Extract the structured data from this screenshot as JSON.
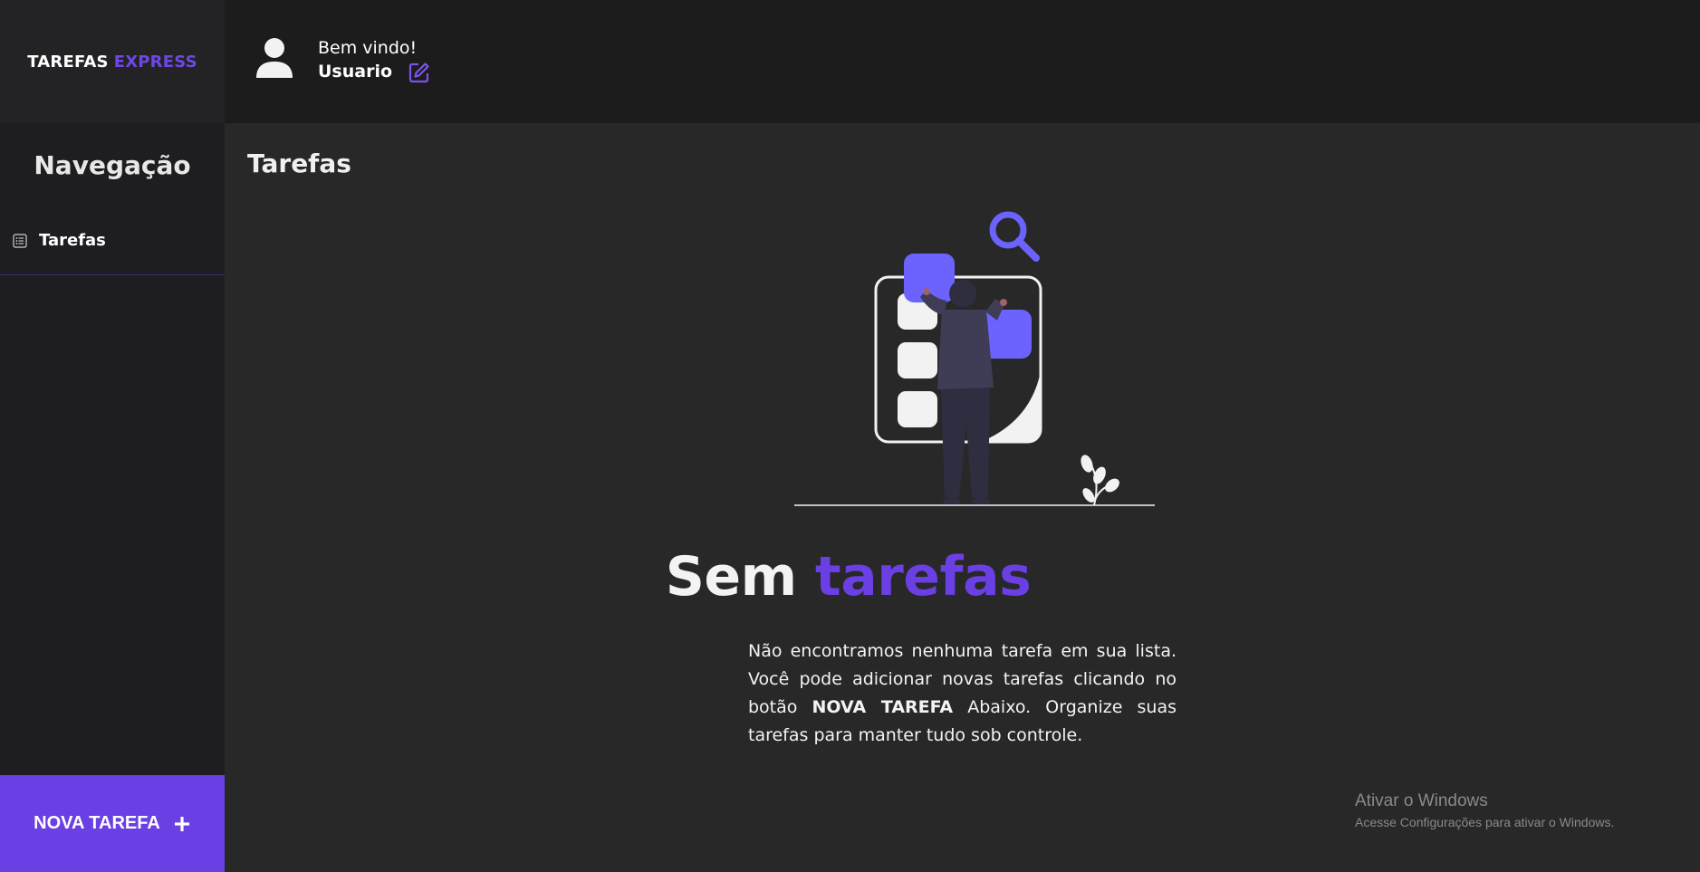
{
  "brand": {
    "part1": "TAREFAS",
    "part2": "EXPRESS"
  },
  "sidebar": {
    "title": "Navegação",
    "items": [
      {
        "label": "Tarefas",
        "icon": "list-icon"
      }
    ],
    "new_task_label": "NOVA TAREFA"
  },
  "header": {
    "welcome": "Bem vindo!",
    "username": "Usuario"
  },
  "main": {
    "title": "Tarefas",
    "empty_title_part1": "Sem",
    "empty_title_part2": "tarefas",
    "desc_part1": "Não encontramos nenhuma tarefa em sua lista. Você pode adicionar novas tarefas clicando no botão",
    "desc_bold": "NOVA TAREFA",
    "desc_part2": "Abaixo. Organize suas tarefas para manter tudo sob controle."
  },
  "watermark": {
    "line1": "Ativar o Windows",
    "line2": "Acesse Configurações para ativar o Windows."
  },
  "colors": {
    "accent": "#6a3fe3",
    "sidebar_bg": "#1e1e20",
    "topbar_bg": "#1c1c1c",
    "main_bg": "#282828"
  }
}
